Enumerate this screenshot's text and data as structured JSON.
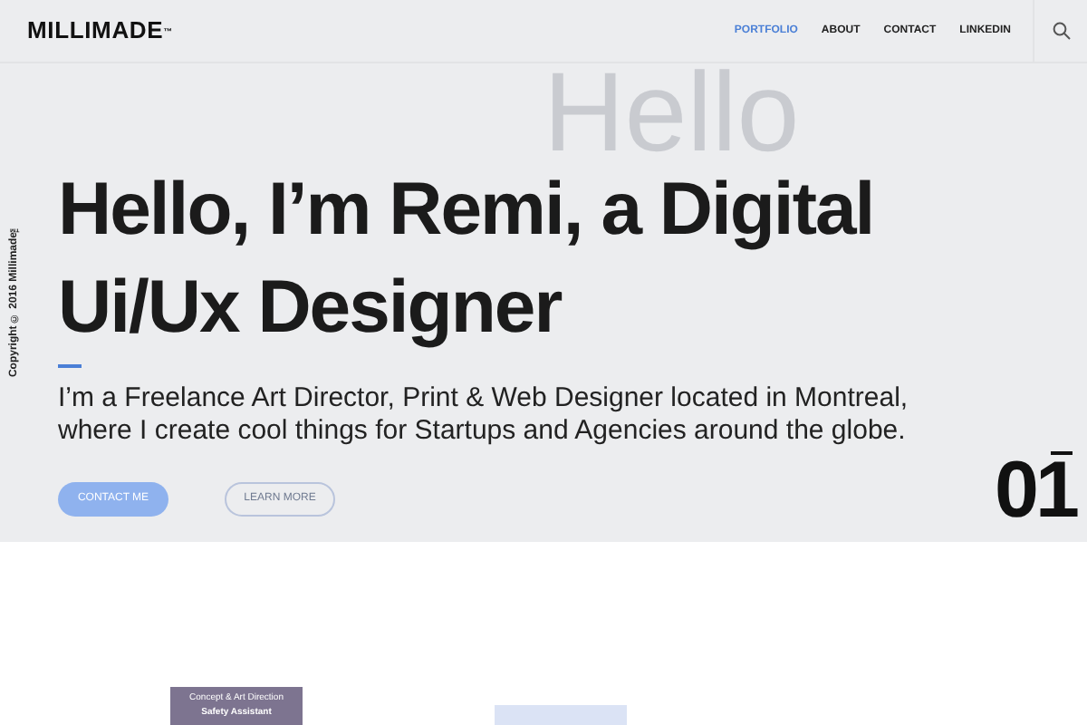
{
  "header": {
    "logo": "MILLIMADE",
    "logo_mark": "™",
    "nav": [
      {
        "label": "PORTFOLIO",
        "selected": true
      },
      {
        "label": "ABOUT",
        "selected": false
      },
      {
        "label": "CONTACT",
        "selected": false
      },
      {
        "label": "LINKEDIN",
        "selected": false
      }
    ]
  },
  "hero": {
    "background_word": "Hello",
    "copyright": "Copyright © 2016 Millimade™",
    "headline": "Hello, I’m Remi, a Digital Ui/Ux Designer",
    "intro": "I’m a Freelance Art Director, Print & Web Designer located in Montreal, where I create cool things for Startups and Agencies around the globe.",
    "buttons": [
      {
        "label": "CONTACT ME",
        "kind": "filled"
      },
      {
        "label": "LEARN MORE",
        "kind": "outline"
      }
    ],
    "slide_number": "01"
  },
  "projects": [
    {
      "category": "Concept & Art Direction",
      "title": "Safety Assistant",
      "color": "#7d7490"
    },
    {
      "color": "#dbe3f5"
    }
  ]
}
